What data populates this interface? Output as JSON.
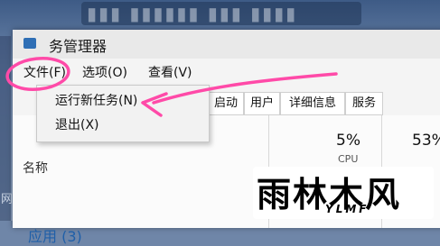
{
  "desktop": {
    "title_text": "▮▮▮ ▮▮▮▮▮▮ ▮▮▮ ▮▮▮▮",
    "edge_text": "网"
  },
  "window": {
    "title": "务管理器"
  },
  "menubar": {
    "items": [
      {
        "label": "文件(F)"
      },
      {
        "label": "选项(O)"
      },
      {
        "label": "查看(V)"
      }
    ]
  },
  "file_menu": {
    "items": [
      {
        "label": "运行新任务(N)"
      },
      {
        "label": "退出(X)"
      }
    ]
  },
  "tabs": [
    {
      "label": "启动"
    },
    {
      "label": "用户"
    },
    {
      "label": "详细信息"
    },
    {
      "label": "服务"
    }
  ],
  "table": {
    "column_name": "名称",
    "cpu_percent": "5%",
    "cpu_label": "CPU",
    "memory_percent": "53%",
    "group_label": "应用 (3)"
  },
  "watermark": {
    "main": "雨林木风",
    "sub": "YLMF"
  },
  "colors": {
    "annotation": "#ff4aa8",
    "link_blue": "#1f5fa8"
  }
}
